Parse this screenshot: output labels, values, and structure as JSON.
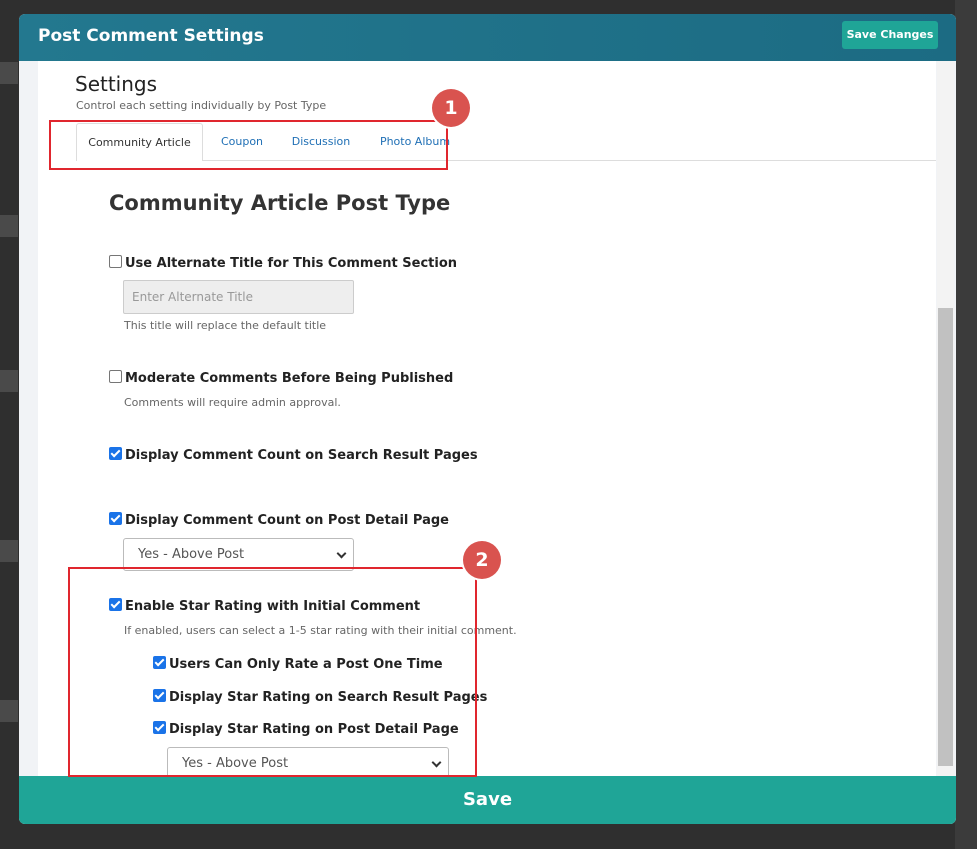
{
  "modal": {
    "title": "Post Comment Settings",
    "save_changes_label": "Save Changes"
  },
  "settings": {
    "title": "Settings",
    "subtitle": "Control each setting individually by Post Type"
  },
  "tabs": [
    {
      "label": "Community Article",
      "active": true
    },
    {
      "label": "Coupon",
      "active": false
    },
    {
      "label": "Discussion",
      "active": false
    },
    {
      "label": "Photo Album",
      "active": false
    }
  ],
  "section": {
    "title": "Community Article Post Type",
    "alternate_title": {
      "label": "Use Alternate Title for This Comment Section",
      "checked": false,
      "placeholder": "Enter Alternate Title",
      "hint": "This title will replace the default title"
    },
    "moderate": {
      "label": "Moderate Comments Before Being Published",
      "checked": false,
      "hint": "Comments will require admin approval."
    },
    "count_search": {
      "label": "Display Comment Count on Search Result Pages",
      "checked": true
    },
    "count_detail": {
      "label": "Display Comment Count on Post Detail Page",
      "checked": true,
      "selected": "Yes - Above Post"
    },
    "star_rating": {
      "label": "Enable Star Rating with Initial Comment",
      "checked": true,
      "hint": "If enabled, users can select a 1-5 star rating with their initial comment.",
      "rate_once": {
        "label": "Users Can Only Rate a Post One Time",
        "checked": true
      },
      "rating_search": {
        "label": "Display Star Rating on Search Result Pages",
        "checked": true
      },
      "rating_detail": {
        "label": "Display Star Rating on Post Detail Page",
        "checked": true,
        "selected": "Yes - Above Post"
      }
    }
  },
  "footer": {
    "save_label": "Save"
  },
  "annotations": [
    "1",
    "2"
  ],
  "colors": {
    "header": "#1f7189",
    "accent": "#1fa597",
    "annotation": "#e0262e",
    "checkbox": "#1a73e8"
  }
}
